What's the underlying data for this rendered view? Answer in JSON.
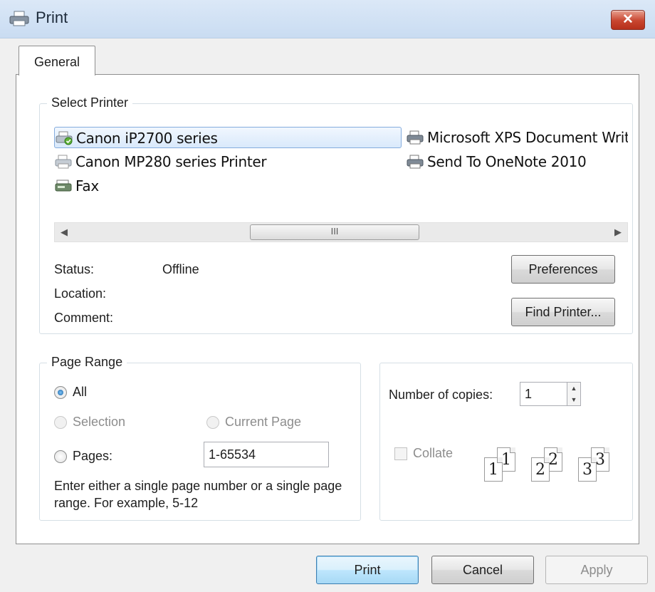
{
  "window": {
    "title": "Print",
    "close_symbol": "✕"
  },
  "tabs": [
    {
      "label": "General"
    }
  ],
  "select_printer": {
    "title": "Select Printer",
    "printers": [
      {
        "name": "Canon iP2700 series",
        "selected": true,
        "icon": "printer-default-icon"
      },
      {
        "name": "Canon MP280 series Printer",
        "selected": false,
        "icon": "printer-icon"
      },
      {
        "name": "Fax",
        "selected": false,
        "icon": "fax-icon"
      },
      {
        "name": "Microsoft XPS Document Writer",
        "selected": false,
        "icon": "printer-icon"
      },
      {
        "name": "Send To OneNote 2010",
        "selected": false,
        "icon": "printer-icon"
      }
    ],
    "scroll_left": "◀",
    "scroll_right": "▶",
    "scroll_grip": "III",
    "status_label": "Status:",
    "status_value": "Offline",
    "location_label": "Location:",
    "location_value": "",
    "comment_label": "Comment:",
    "comment_value": "",
    "preferences_button": "Preferences",
    "find_printer_button": "Find Printer..."
  },
  "page_range": {
    "title": "Page Range",
    "all_label": "All",
    "selection_label": "Selection",
    "current_page_label": "Current Page",
    "pages_label": "Pages:",
    "pages_value": "1-65534",
    "selected_option": "All",
    "description": "Enter either a single page number or a single page range.  For example, 5-12"
  },
  "copies": {
    "number_label": "Number of copies:",
    "number_value": "1",
    "spin_up": "▲",
    "spin_down": "▼",
    "collate_label": "Collate",
    "collate_checked": false,
    "collate_pages": [
      "1",
      "1",
      "2",
      "2",
      "3",
      "3"
    ]
  },
  "buttons": {
    "print": "Print",
    "cancel": "Cancel",
    "apply": "Apply"
  },
  "colors": {
    "titlebar": "#c9dcf2",
    "close_button": "#c8452f",
    "selection": "#d9e9fb",
    "window_bg": "#f0f0f0"
  }
}
